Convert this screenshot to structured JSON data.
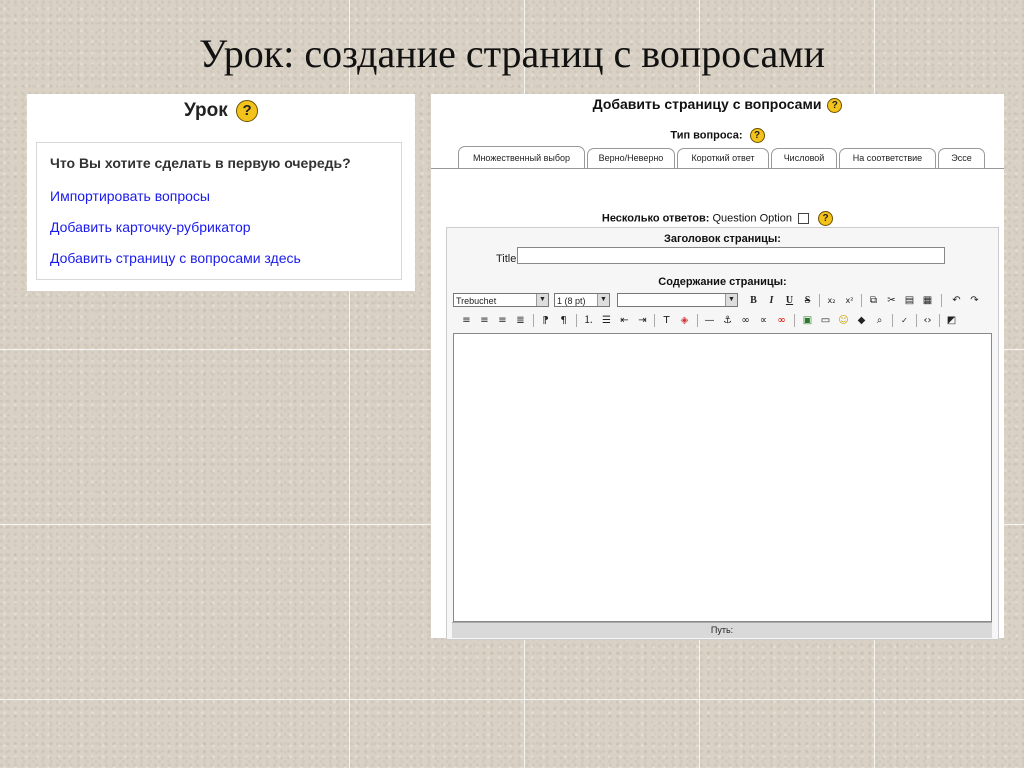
{
  "slide": {
    "title": "Урок: создание страниц с вопросами"
  },
  "lesson": {
    "title": "Урок",
    "help": "?",
    "question": "Что Вы хотите сделать в первую очередь?",
    "links": [
      "Импортировать вопросы",
      "Добавить карточку-рубрикатор",
      "Добавить страницу с вопросами здесь"
    ]
  },
  "editor": {
    "heading": "Добавить страницу с вопросами",
    "help": "?",
    "qtype_label": "Тип вопроса:",
    "tabs": [
      "Множественный выбор",
      "Верно/Неверно",
      "Короткий ответ",
      "Числовой",
      "На соответствие",
      "Эссе"
    ],
    "multi_label": "Несколько ответов:",
    "multi_option": "Question Option",
    "page_title_label": "Заголовок страницы:",
    "title_field_label": "Title",
    "title_value": "",
    "content_label": "Содержание страницы:",
    "font_select": "Trebuchet",
    "size_select": "1 (8 pt)",
    "style_select": "",
    "path_label": "Путь:"
  },
  "toolbar": {
    "bold": "B",
    "italic": "I",
    "underline": "U",
    "strike": "S",
    "subscript": "x₂",
    "superscript": "x²"
  }
}
